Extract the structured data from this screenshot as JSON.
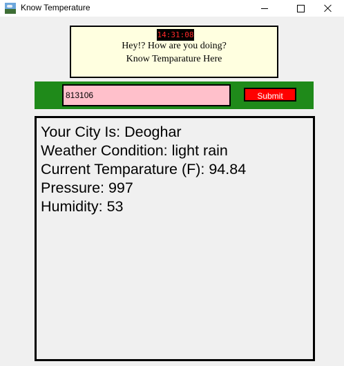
{
  "window": {
    "title": "Know Temperature"
  },
  "clock": {
    "time": "14:31:08"
  },
  "greeting": {
    "line1": "Hey!? How are you doing?",
    "line2": "Know Temparature Here"
  },
  "form": {
    "zip_value": "813106",
    "submit_label": "Submit"
  },
  "results": {
    "city": "Your City Is: Deoghar",
    "condition": "Weather Condition: light rain",
    "temperature": "Current Temparature (F): 94.84",
    "pressure": "Pressure: 997",
    "humidity": "Humidity: 53"
  },
  "colors": {
    "info_bg": "#ffffe0",
    "clock_text": "#ff2a2a",
    "bar_green": "#1f8a1a",
    "input_pink": "#ffc0cb",
    "button_red": "#ff0000"
  },
  "icons": {
    "app": "landscape-icon",
    "minimize": "minimize-icon",
    "maximize": "maximize-icon",
    "close": "close-icon"
  }
}
